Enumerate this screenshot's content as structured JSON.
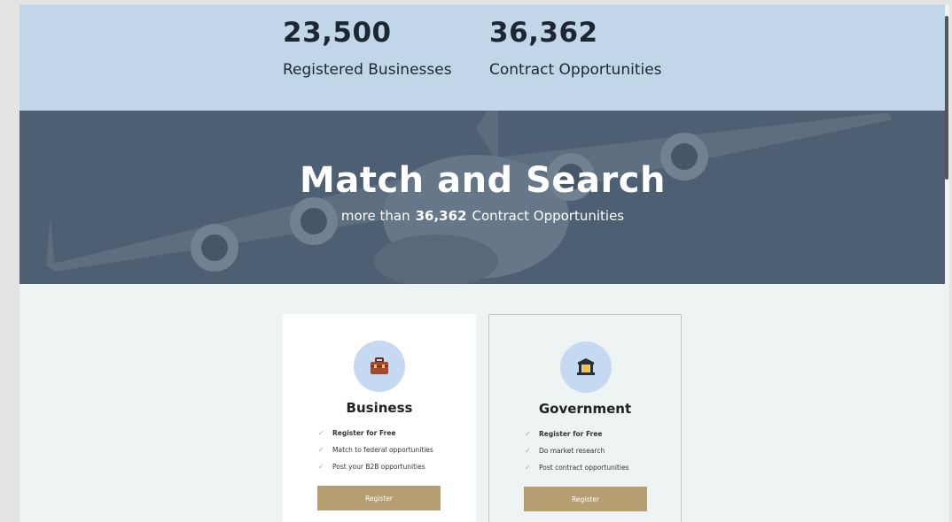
{
  "stats": [
    {
      "number": "23,500",
      "label": "Registered Businesses"
    },
    {
      "number": "36,362",
      "label": "Contract Opportunities"
    }
  ],
  "hero": {
    "title": "Match and Search",
    "subtitle_prefix": "more than",
    "subtitle_number": "36,362",
    "subtitle_suffix": "Contract Opportunities"
  },
  "cards": [
    {
      "title": "Business",
      "icon": "briefcase-icon",
      "features": [
        "Register for Free",
        "Match to federal opportunities",
        "Post your B2B opportunities"
      ],
      "button": "Register"
    },
    {
      "title": "Government",
      "icon": "government-building-icon",
      "features": [
        "Register for Free",
        "Do market research",
        "Post contract opportunities"
      ],
      "button": "Register"
    }
  ],
  "colors": {
    "stats_band": "#c2d6ea",
    "hero_overlay": "#56687a",
    "button": "#b59f72",
    "icon_circle": "#c5d9f2",
    "check": "#9fb08a"
  }
}
